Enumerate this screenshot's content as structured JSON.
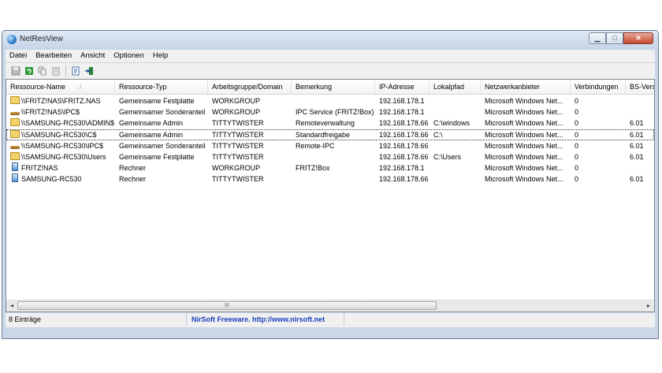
{
  "window": {
    "title": "NetResView"
  },
  "menu": [
    "Datei",
    "Bearbeiten",
    "Ansicht",
    "Optionen",
    "Help"
  ],
  "toolbar": {
    "icons": [
      "save-icon",
      "refresh-icon",
      "copy-icon",
      "properties-icon",
      "report-icon",
      "exit-icon"
    ]
  },
  "columns": [
    "Ressource-Name",
    "Ressource-Typ",
    "Arbeitsgruppe/Domain",
    "Bemerkung",
    "IP-Adresse",
    "Lokalpfad",
    "Netzwerkanbieter",
    "Verbindungen",
    "BS-Version"
  ],
  "sort_indicator": "/",
  "rows": [
    [
      "\\\\FRITZ!NAS\\FRITZ.NAS",
      "Gemeinsame Festplatte",
      "WORKGROUP",
      "",
      "192.168.178.1",
      "",
      "Microsoft Windows Net...",
      "0",
      ""
    ],
    [
      "\\\\FRITZ!NAS\\IPC$",
      "Gemeinsamer Sonderanteil",
      "WORKGROUP",
      "IPC Service (FRITZ!Box)",
      "192.168.178.1",
      "",
      "Microsoft Windows Net...",
      "0",
      ""
    ],
    [
      "\\\\SAMSUNG-RC530\\ADMIN$",
      "Gemeinsame Admin",
      "TITTYTWISTER",
      "Remoteverwaltung",
      "192.168.178.66",
      "C:\\windows",
      "Microsoft Windows Net...",
      "0",
      "6.01"
    ],
    [
      "\\\\SAMSUNG-RC530\\C$",
      "Gemeinsame Admin",
      "TITTYTWISTER",
      "Standardfreigabe",
      "192.168.178.66",
      "C:\\",
      "Microsoft Windows Net...",
      "0",
      "6.01"
    ],
    [
      "\\\\SAMSUNG-RC530\\IPC$",
      "Gemeinsamer Sonderanteil",
      "TITTYTWISTER",
      "Remote-IPC",
      "192.168.178.66",
      "",
      "Microsoft Windows Net...",
      "0",
      "6.01"
    ],
    [
      "\\\\SAMSUNG-RC530\\Users",
      "Gemeinsame Festplatte",
      "TITTYTWISTER",
      "",
      "192.168.178.66",
      "C:\\Users",
      "Microsoft Windows Net...",
      "0",
      "6.01"
    ],
    [
      "FRITZ!NAS",
      "Rechner",
      "WORKGROUP",
      "FRITZ!Box",
      "192.168.178.1",
      "",
      "Microsoft Windows Net...",
      "0",
      ""
    ],
    [
      "SAMSUNG-RC530",
      "Rechner",
      "TITTYTWISTER",
      "",
      "192.168.178.66",
      "",
      "Microsoft Windows Net...",
      "0",
      "6.01"
    ]
  ],
  "row_icons": [
    "folder-icon",
    "pipe-icon",
    "folder-icon",
    "folder-icon",
    "pipe-icon",
    "folder-icon",
    "computer-icon",
    "computer-icon"
  ],
  "scrollbar": {
    "thumb_grip": "III"
  },
  "status": {
    "count": "8 Einträge",
    "link": "NirSoft Freeware.  http://www.nirsoft.net"
  }
}
